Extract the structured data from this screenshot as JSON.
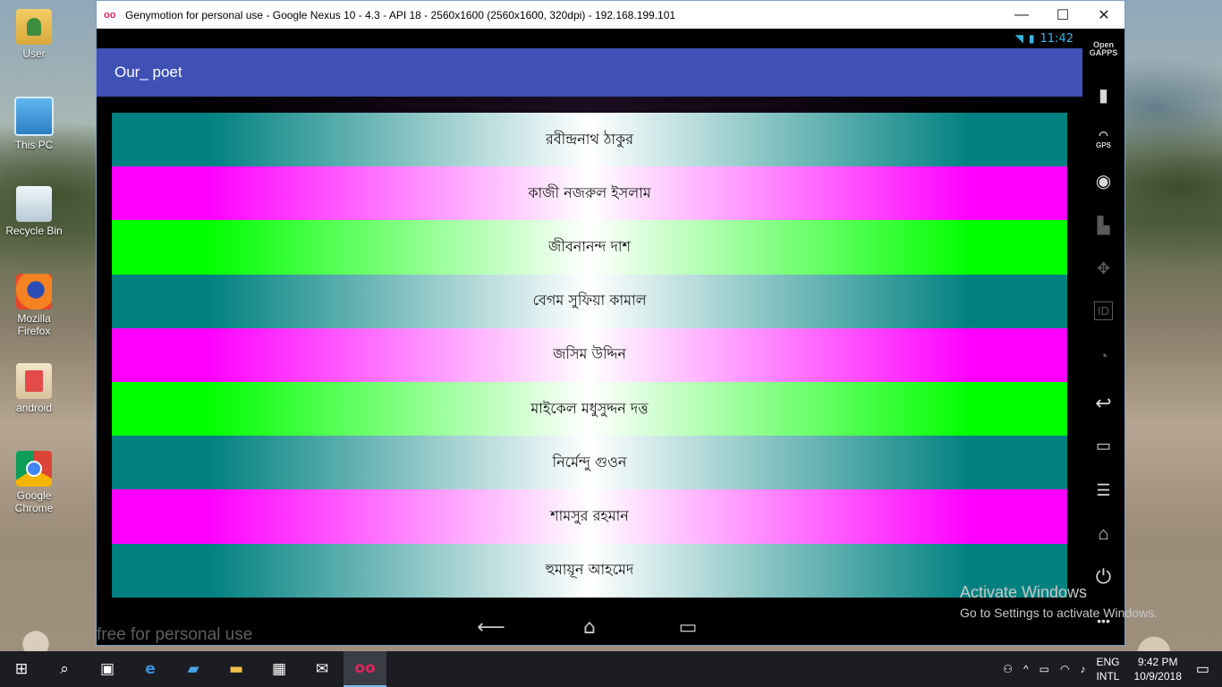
{
  "desktop": {
    "icons": [
      {
        "label": "User",
        "icon": "user-folder-icon"
      },
      {
        "label": "This PC",
        "icon": "computer-icon"
      },
      {
        "label": "Recycle Bin",
        "icon": "recycle-bin-icon"
      },
      {
        "label": "Mozilla Firefox",
        "icon": "firefox-icon"
      },
      {
        "label": "android",
        "icon": "android-package-icon"
      },
      {
        "label": "Google Chrome",
        "icon": "chrome-icon"
      }
    ]
  },
  "window": {
    "title": "Genymotion for personal use - Google Nexus 10 - 4.3 - API 18 - 2560x1600 (2560x1600, 320dpi) - 192.168.199.101",
    "controls": {
      "minimize": "—",
      "maximize": "☐",
      "close": "✕"
    }
  },
  "android": {
    "status_time": "11:42",
    "app_title": "Our_ poet",
    "poets": [
      {
        "name": "রবীন্দ্রনাথ ঠাকুর",
        "color": "teal"
      },
      {
        "name": "কাজী নজরুল ইসলাম",
        "color": "magenta"
      },
      {
        "name": "জীবনানন্দ দাশ",
        "color": "green"
      },
      {
        "name": "বেগম সুফিয়া কামাল",
        "color": "teal"
      },
      {
        "name": "জসিম উদ্দিন",
        "color": "magenta"
      },
      {
        "name": "মাইকেল মধুসুদ্দন দত্ত",
        "color": "green"
      },
      {
        "name": "নির্মেন্দু গুওন",
        "color": "teal"
      },
      {
        "name": "শামসুর রহমান",
        "color": "magenta"
      },
      {
        "name": "হুমায়ূন আহমেদ",
        "color": "teal"
      }
    ],
    "nav": {
      "back": "⟵",
      "home": "⌂",
      "recents": "▭"
    },
    "watermark": "free for personal use"
  },
  "genymotion_sidebar": {
    "open_gapps": "Open GAPPS",
    "gps": "GPS",
    "id": "ID",
    "more": "•••"
  },
  "activation": {
    "line1": "Activate Windows",
    "line2": "Go to Settings to activate Windows."
  },
  "taskbar": {
    "lang_top": "ENG",
    "lang_bottom": "INTL",
    "time": "9:42 PM",
    "date": "10/9/2018"
  },
  "colors": {
    "teal": "#008080",
    "magenta": "#ff00ff",
    "green": "#00ff00",
    "actionbar": "#3f51b5",
    "status": "#33b5e5"
  }
}
